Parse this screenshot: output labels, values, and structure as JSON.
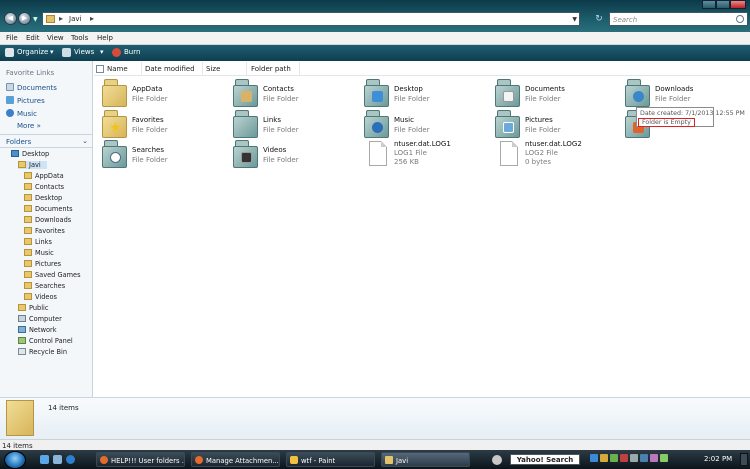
{
  "address_bar": {
    "crumb": "Javi",
    "search_placeholder": "Search"
  },
  "menu": [
    "File",
    "Edit",
    "View",
    "Tools",
    "Help"
  ],
  "toolbar": {
    "organize": "Organize",
    "views": "Views",
    "burn": "Burn"
  },
  "nav_pane": {
    "favorites_header": "Favorite Links",
    "favorites": [
      "Documents",
      "Pictures",
      "Music"
    ],
    "more": "More",
    "folders_header": "Folders",
    "tree": [
      "Desktop",
      "Javi",
      "AppData",
      "Contacts",
      "Desktop",
      "Documents",
      "Downloads",
      "Favorites",
      "Links",
      "Music",
      "Pictures",
      "Saved Games",
      "Searches",
      "Videos",
      "Public",
      "Computer",
      "Network",
      "Control Panel",
      "Recycle Bin"
    ]
  },
  "columns": [
    "Name",
    "Date modified",
    "Size",
    "Folder path"
  ],
  "items": [
    {
      "name": "AppData",
      "type": "File Folder"
    },
    {
      "name": "Contacts",
      "type": "File Folder"
    },
    {
      "name": "Desktop",
      "type": "File Folder"
    },
    {
      "name": "Documents",
      "type": "File Folder"
    },
    {
      "name": "Downloads",
      "type": "File Folder"
    },
    {
      "name": "Favorites",
      "type": "File Folder"
    },
    {
      "name": "Links",
      "type": "File Folder"
    },
    {
      "name": "Music",
      "type": "File Folder"
    },
    {
      "name": "Pictures",
      "type": "File Folder"
    },
    {
      "name": "Searches",
      "type": "File Folder"
    },
    {
      "name": "Videos",
      "type": "File Folder"
    },
    {
      "name": "ntuser.dat.LOG1",
      "type": "LOG1 File",
      "size": "256 KB"
    },
    {
      "name": "ntuser.dat.LOG2",
      "type": "LOG2 File",
      "size": "0 bytes"
    }
  ],
  "tooltip": {
    "date": "Date created: 7/1/2013 12:55 PM",
    "empty": "Folder is Empty"
  },
  "details": {
    "count": "14 items"
  },
  "status": {
    "count": "14 items"
  },
  "taskbar": {
    "tasks": [
      "HELP!!! User folders ...",
      "Manage Attachmen...",
      "wtf - Paint",
      "Javi"
    ],
    "yahoo": "Yahoo! Search",
    "clock": "2:02 PM"
  },
  "colors": {
    "accent": "#1a4e8a",
    "toolbar_bg": "#134657",
    "tooltip_highlight": "#e02020"
  }
}
